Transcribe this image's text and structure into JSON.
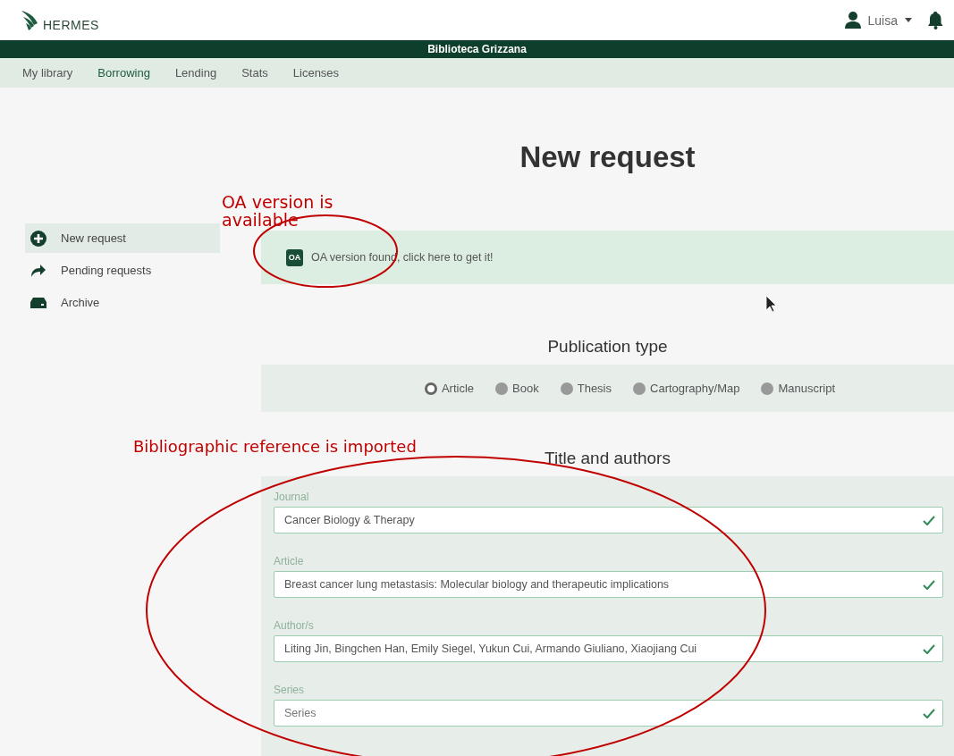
{
  "header": {
    "logo": "HERMES",
    "user": "Luisa"
  },
  "library_bar": {
    "title": "Biblioteca Grizzana"
  },
  "nav": [
    {
      "label": "My library",
      "selected": false
    },
    {
      "label": "Borrowing",
      "selected": true
    },
    {
      "label": "Lending",
      "selected": false
    },
    {
      "label": "Stats",
      "selected": false
    },
    {
      "label": "Licenses",
      "selected": false
    }
  ],
  "sidebar": [
    {
      "label": "New request",
      "kind": "add",
      "selected": true
    },
    {
      "label": "Pending requests",
      "kind": "forward",
      "selected": false
    },
    {
      "label": "Archive",
      "kind": "archive",
      "selected": false
    }
  ],
  "page_title": "New request",
  "oa_banner": {
    "badge": "OA",
    "text": "OA version found, click here to get it!"
  },
  "publication_type": {
    "heading": "Publication type",
    "options": [
      {
        "label": "Article",
        "selected": true
      },
      {
        "label": "Book",
        "selected": false
      },
      {
        "label": "Thesis",
        "selected": false
      },
      {
        "label": "Cartography/Map",
        "selected": false
      },
      {
        "label": "Manuscript",
        "selected": false
      }
    ]
  },
  "title_and_authors": {
    "heading": "Title and authors",
    "fields": [
      {
        "label": "Journal",
        "value": "Cancer Biology & Therapy",
        "valid": true
      },
      {
        "label": "Article",
        "value": "Breast cancer lung metastasis: Molecular biology and therapeutic implications",
        "valid": true
      },
      {
        "label": "Author/s",
        "value": "Liting Jin, Bingchen Han, Emily Siegel, Yukun Cui, Armando Giuliano, Xiaojiang Cui",
        "valid": true
      },
      {
        "label": "Series",
        "placeholder": "Series",
        "valid": true
      }
    ]
  },
  "annotations": [
    {
      "text": "OA version is available"
    },
    {
      "text": "Bibliographic reference is imported"
    }
  ]
}
